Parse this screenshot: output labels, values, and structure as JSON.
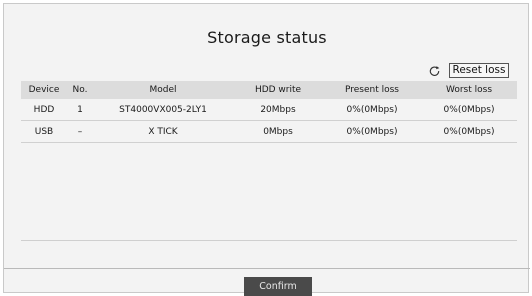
{
  "dialog": {
    "title": "Storage status",
    "reset_label": "Reset loss",
    "confirm_label": "Confirm"
  },
  "table": {
    "columns": [
      "Device",
      "No.",
      "Model",
      "HDD write",
      "Present loss",
      "Worst loss"
    ],
    "rows": [
      [
        "HDD",
        "1",
        "ST4000VX005-2LY1",
        "20Mbps",
        "0%(0Mbps)",
        "0%(0Mbps)"
      ],
      [
        "USB",
        "–",
        "X TICK",
        "0Mbps",
        "0%(0Mbps)",
        "0%(0Mbps)"
      ]
    ]
  },
  "icons": {
    "refresh": "refresh-icon"
  }
}
